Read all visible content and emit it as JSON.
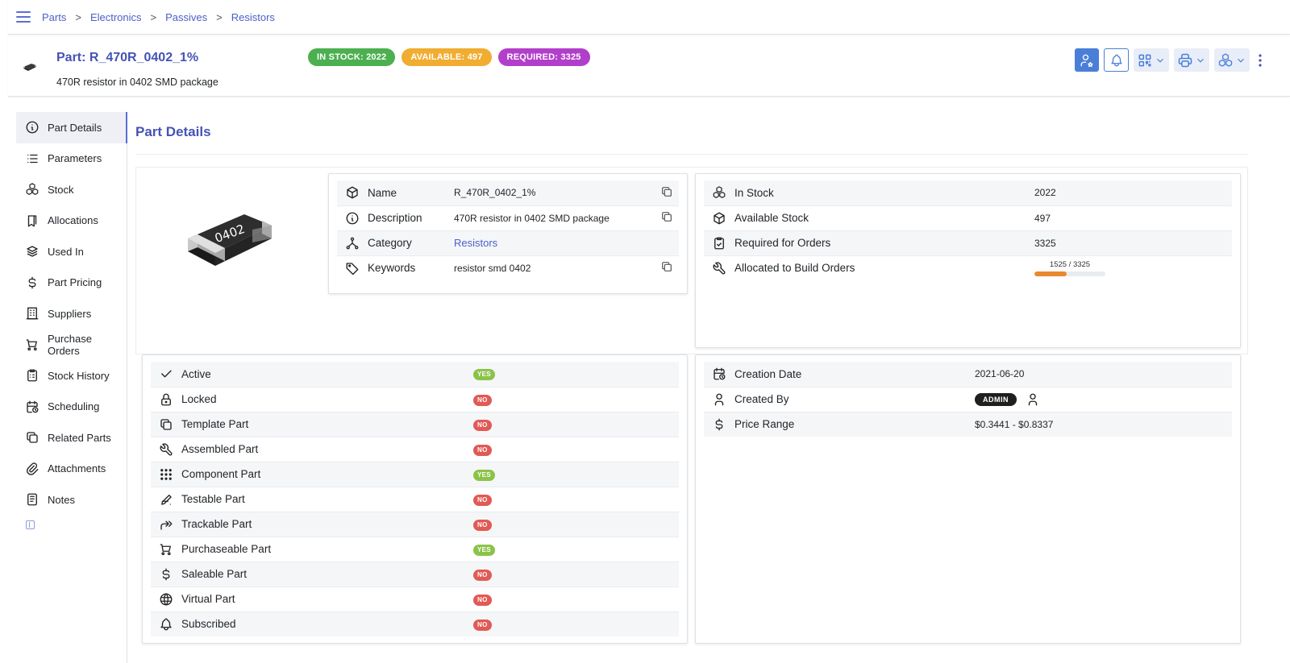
{
  "breadcrumb": [
    "Parts",
    "Electronics",
    "Passives",
    "Resistors"
  ],
  "breadcrumb_separator": ">",
  "header": {
    "title": "Part: R_470R_0402_1%",
    "subtitle": "470R resistor in 0402 SMD package",
    "badges": [
      {
        "label": "IN STOCK: 2022",
        "color": "#4caf50"
      },
      {
        "label": "AVAILABLE: 497",
        "color": "#f0ad31"
      },
      {
        "label": "REQUIRED: 3325",
        "color": "#b13fca"
      }
    ],
    "actions": [
      "user-star-icon",
      "bell-icon",
      "qr-code-icon",
      "printer-icon",
      "stock-icon",
      "kebab-icon"
    ]
  },
  "nav": [
    {
      "label": "Part Details",
      "icon": "info-icon",
      "active": true
    },
    {
      "label": "Parameters",
      "icon": "list-icon"
    },
    {
      "label": "Stock",
      "icon": "stock-icon"
    },
    {
      "label": "Allocations",
      "icon": "bookmark-icon"
    },
    {
      "label": "Used In",
      "icon": "layers-icon"
    },
    {
      "label": "Part Pricing",
      "icon": "dollar-icon"
    },
    {
      "label": "Suppliers",
      "icon": "building-icon"
    },
    {
      "label": "Purchase Orders",
      "icon": "cart-icon"
    },
    {
      "label": "Stock History",
      "icon": "clipboard-icon"
    },
    {
      "label": "Scheduling",
      "icon": "calendar-clock-icon"
    },
    {
      "label": "Related Parts",
      "icon": "copy-icon"
    },
    {
      "label": "Attachments",
      "icon": "paperclip-icon"
    },
    {
      "label": "Notes",
      "icon": "notes-icon"
    }
  ],
  "section_title": "Part Details",
  "image": {
    "label": "0402"
  },
  "info": [
    {
      "label": "Name",
      "value": "R_470R_0402_1%",
      "icon": "package-icon",
      "copy": true
    },
    {
      "label": "Description",
      "value": "470R resistor in 0402 SMD package",
      "icon": "info-icon",
      "copy": true
    },
    {
      "label": "Category",
      "value": "Resistors",
      "icon": "sitemap-icon",
      "link": true
    },
    {
      "label": "Keywords",
      "value": "resistor smd 0402",
      "icon": "tag-icon",
      "copy": true
    }
  ],
  "stock": [
    {
      "label": "In Stock",
      "value": "2022",
      "icon": "stock-icon"
    },
    {
      "label": "Available Stock",
      "value": "497",
      "icon": "package-icon"
    },
    {
      "label": "Required for Orders",
      "value": "3325",
      "icon": "clipboard-check-icon"
    },
    {
      "label": "Allocated to Build Orders",
      "progress_label": "1525 / 3325",
      "allocated": 1525,
      "required": 3325,
      "icon": "tool-icon"
    }
  ],
  "flags": [
    {
      "label": "Active",
      "value": "YES",
      "icon": "check-icon"
    },
    {
      "label": "Locked",
      "value": "NO",
      "icon": "lock-icon"
    },
    {
      "label": "Template Part",
      "value": "NO",
      "icon": "template-icon"
    },
    {
      "label": "Assembled Part",
      "value": "NO",
      "icon": "tool-icon"
    },
    {
      "label": "Component Part",
      "value": "YES",
      "icon": "grid-dots-icon"
    },
    {
      "label": "Testable Part",
      "value": "NO",
      "icon": "test-icon"
    },
    {
      "label": "Trackable Part",
      "value": "NO",
      "icon": "route-icon"
    },
    {
      "label": "Purchaseable Part",
      "value": "YES",
      "icon": "cart-icon"
    },
    {
      "label": "Saleable Part",
      "value": "NO",
      "icon": "dollar-icon"
    },
    {
      "label": "Virtual Part",
      "value": "NO",
      "icon": "world-icon"
    },
    {
      "label": "Subscribed",
      "value": "NO",
      "icon": "bell-icon"
    }
  ],
  "meta": [
    {
      "label": "Creation Date",
      "value": "2021-06-20",
      "icon": "calendar-clock-icon"
    },
    {
      "label": "Created By",
      "value": "ADMIN",
      "icon": "user-icon",
      "pill": true
    },
    {
      "label": "Price Range",
      "value": "$0.3441 - $0.8337",
      "icon": "dollar-icon"
    }
  ],
  "colors": {
    "accent": "#4553b5",
    "link": "#4c5fc8",
    "yes": "#8bc34a",
    "no": "#e15a55",
    "progress": "#e8892f"
  }
}
